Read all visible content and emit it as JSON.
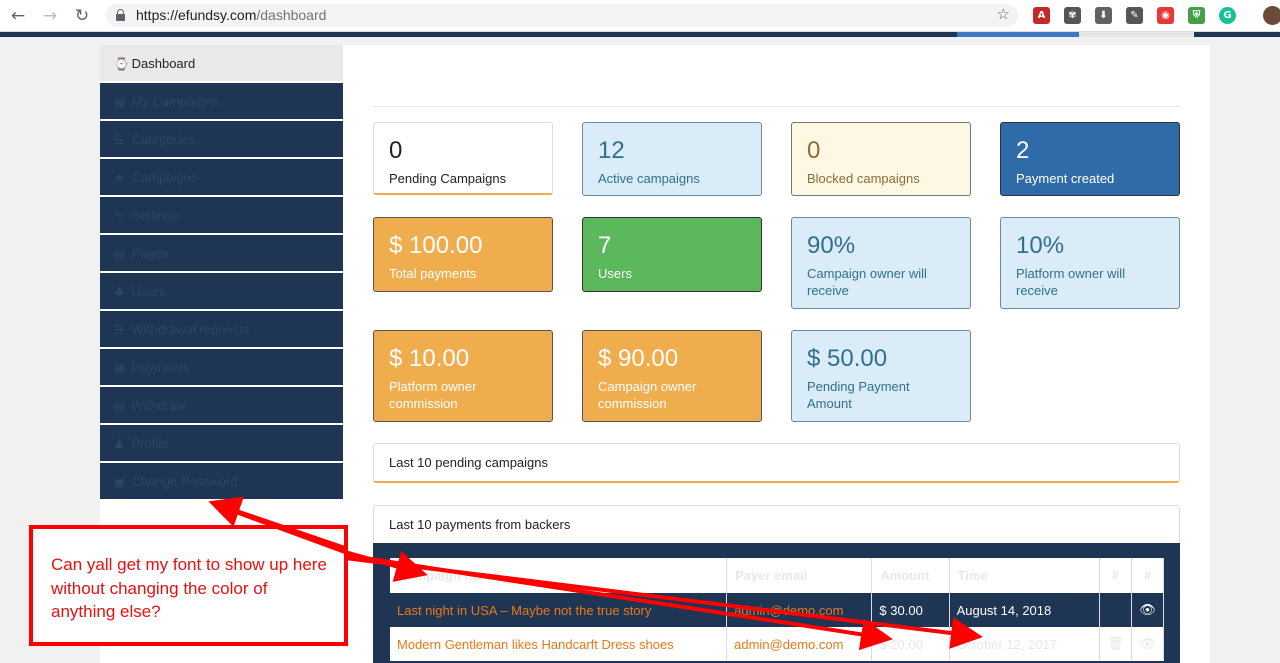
{
  "browser": {
    "url_host": "https://efundsy.com",
    "url_path": "/dashboard",
    "extensions": [
      {
        "name": "adobe-extension-icon",
        "color": "#c62828",
        "glyph": "A"
      },
      {
        "name": "globe-extension-icon",
        "color": "#555555",
        "glyph": "✾"
      },
      {
        "name": "download-extension-icon",
        "color": "#5f6368",
        "glyph": "⬇"
      },
      {
        "name": "dropper-extension-icon",
        "color": "#555555",
        "glyph": "✎"
      },
      {
        "name": "camera-extension-icon",
        "color": "#e53935",
        "glyph": "◉"
      },
      {
        "name": "shield-extension-icon",
        "color": "#43a047",
        "glyph": "⛨"
      },
      {
        "name": "grammarly-extension-icon",
        "color": "#15c39a",
        "glyph": "G"
      }
    ]
  },
  "sidebar": {
    "items": [
      {
        "icon": "⌚",
        "label": "Dashboard"
      },
      {
        "icon": "▦",
        "label": "My Campaigns"
      },
      {
        "icon": "☰",
        "label": "Categories"
      },
      {
        "icon": "★",
        "label": "Campaigns"
      },
      {
        "icon": "✎",
        "label": "Settings"
      },
      {
        "icon": "▤",
        "label": "Pages"
      },
      {
        "icon": "♣",
        "label": "Users"
      },
      {
        "icon": "☰",
        "label": "Withdrawal requests"
      },
      {
        "icon": "▦",
        "label": "Payments"
      },
      {
        "icon": "▤",
        "label": "Withdraw"
      },
      {
        "icon": "♟",
        "label": "Profile"
      },
      {
        "icon": "▣",
        "label": "Change Password"
      }
    ]
  },
  "stats": [
    {
      "value": "0",
      "label": "Pending Campaigns"
    },
    {
      "value": "12",
      "label": "Active campaigns"
    },
    {
      "value": "0",
      "label": "Blocked campaigns"
    },
    {
      "value": "2",
      "label": "Payment created"
    },
    {
      "value": "$ 100.00",
      "label": "Total payments"
    },
    {
      "value": "7",
      "label": "Users"
    },
    {
      "value": "90%",
      "label": "Campaign owner will receive"
    },
    {
      "value": "10%",
      "label": "Platform owner will receive"
    },
    {
      "value": "$ 10.00",
      "label": "Platform owner commission"
    },
    {
      "value": "$ 90.00",
      "label": "Campaign owner commission"
    },
    {
      "value": "$ 50.00",
      "label": "Pending Payment Amount"
    }
  ],
  "panels": {
    "pending_title": "Last 10 pending campaigns",
    "payments_title": "Last 10 payments from backers"
  },
  "payments_table": {
    "headers": [
      "Campaign name",
      "Payer email",
      "Amount",
      "Time",
      "#",
      "#"
    ],
    "rows": [
      {
        "campaign": "Last night in USA – Maybe not the true story",
        "email": "admin@demo.com",
        "amount": "$ 30.00",
        "time": "August 14, 2018",
        "delete": "",
        "view": "👁"
      },
      {
        "campaign": "Modern Gentleman likes Handcarft Dress shoes",
        "email": "admin@demo.com",
        "amount": "$ 20.00",
        "time": "October 12, 2017",
        "delete": "🗑",
        "view": "👁"
      }
    ]
  },
  "annotation": {
    "text": "Can yall get my font to show up here without changing the color of anything else?",
    "color": "#ff0000"
  }
}
